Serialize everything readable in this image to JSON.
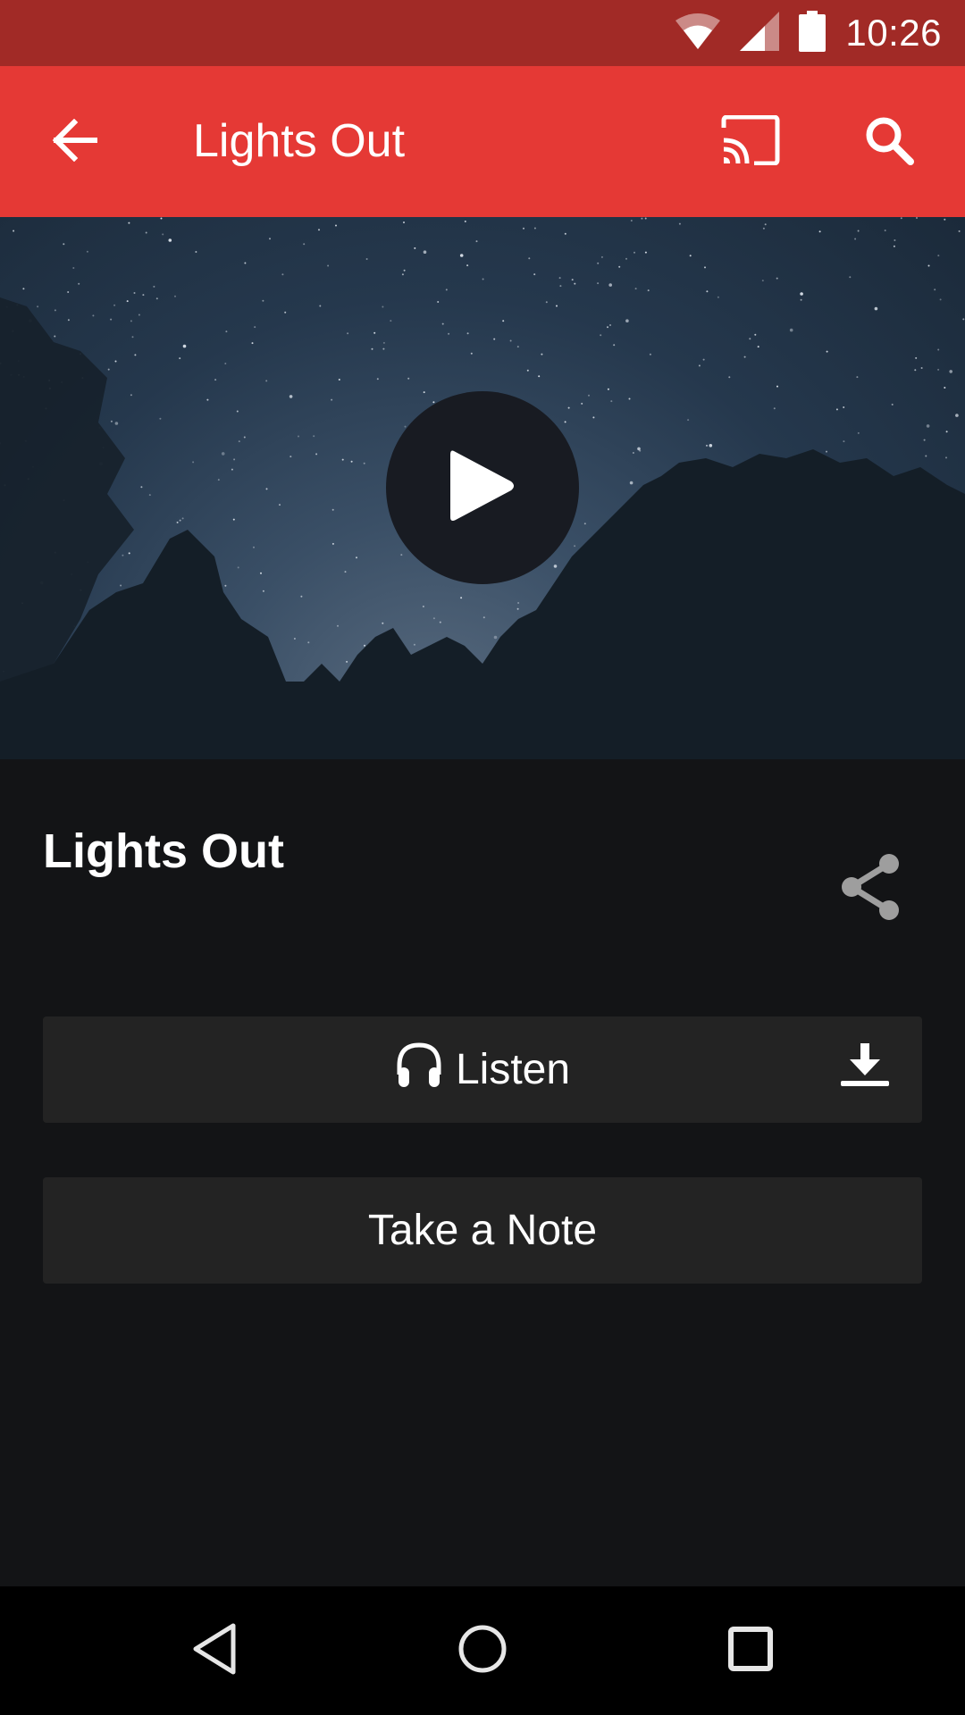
{
  "status_bar": {
    "time": "10:26",
    "icons": [
      "wifi-icon",
      "cell-signal-icon",
      "battery-icon"
    ]
  },
  "app_bar": {
    "title": "Lights Out",
    "back_icon": "arrow-back-icon",
    "actions": [
      "cast-icon",
      "search-icon"
    ]
  },
  "hero": {
    "play_icon": "play-icon"
  },
  "episode": {
    "title": "Lights Out",
    "share_icon": "share-icon"
  },
  "actions": {
    "listen_label": "Listen",
    "listen_icon": "headphones-icon",
    "download_icon": "download-icon",
    "note_label": "Take a Note"
  },
  "nav_bar": {
    "buttons": [
      "nav-back-icon",
      "nav-home-icon",
      "nav-recents-icon"
    ]
  },
  "colors": {
    "status_bar": "#a12a26",
    "app_bar": "#e53935",
    "background": "#131416",
    "button": "#232323",
    "share_icon": "#9e9e9e"
  }
}
